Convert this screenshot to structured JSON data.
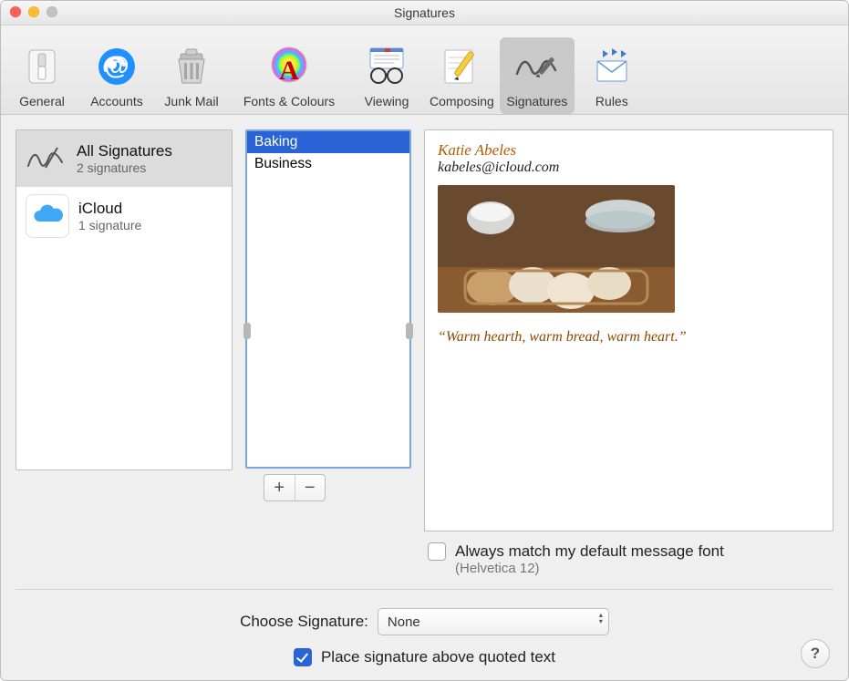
{
  "window": {
    "title": "Signatures"
  },
  "toolbar": {
    "items": [
      {
        "label": "General"
      },
      {
        "label": "Accounts"
      },
      {
        "label": "Junk Mail"
      },
      {
        "label": "Fonts & Colours"
      },
      {
        "label": "Viewing"
      },
      {
        "label": "Composing"
      },
      {
        "label": "Signatures"
      },
      {
        "label": "Rules"
      }
    ]
  },
  "accounts": {
    "items": [
      {
        "title": "All Signatures",
        "subtitle": "2 signatures",
        "selected": true,
        "icon": "signature-icon"
      },
      {
        "title": "iCloud",
        "subtitle": "1 signature",
        "selected": false,
        "icon": "icloud-icon"
      }
    ]
  },
  "signatureNames": {
    "items": [
      {
        "label": "Baking",
        "selected": true
      },
      {
        "label": "Business",
        "selected": false
      }
    ]
  },
  "preview": {
    "name": "Katie Abeles",
    "email": "kabeles@icloud.com",
    "quote": "“Warm hearth, warm bread, warm heart.”"
  },
  "matchFont": {
    "checked": false,
    "label": "Always match my default message font",
    "sublabel": "(Helvetica 12)"
  },
  "chooseSignature": {
    "label": "Choose Signature:",
    "value": "None"
  },
  "placeAbove": {
    "checked": true,
    "label": "Place signature above quoted text"
  },
  "buttons": {
    "plus": "+",
    "minus": "−",
    "help": "?"
  }
}
